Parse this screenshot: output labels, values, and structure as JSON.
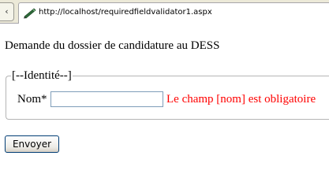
{
  "browser": {
    "tab_title": "http://localhost/requiredfieldvalidator1.aspx",
    "scroll_left_glyph": "‹",
    "tab_icon": "page-pen-icon"
  },
  "page": {
    "heading": "Demande du dossier de candidature au DESS",
    "fieldset_legend": "[--Identité--]",
    "name_label": "Nom*",
    "name_input_value": "",
    "name_error": "Le champ [nom] est obligatoire",
    "submit_label": "Envoyer"
  },
  "colors": {
    "error_text": "#ff0000",
    "input_border": "#7f9db9",
    "button_border": "#003c74"
  }
}
